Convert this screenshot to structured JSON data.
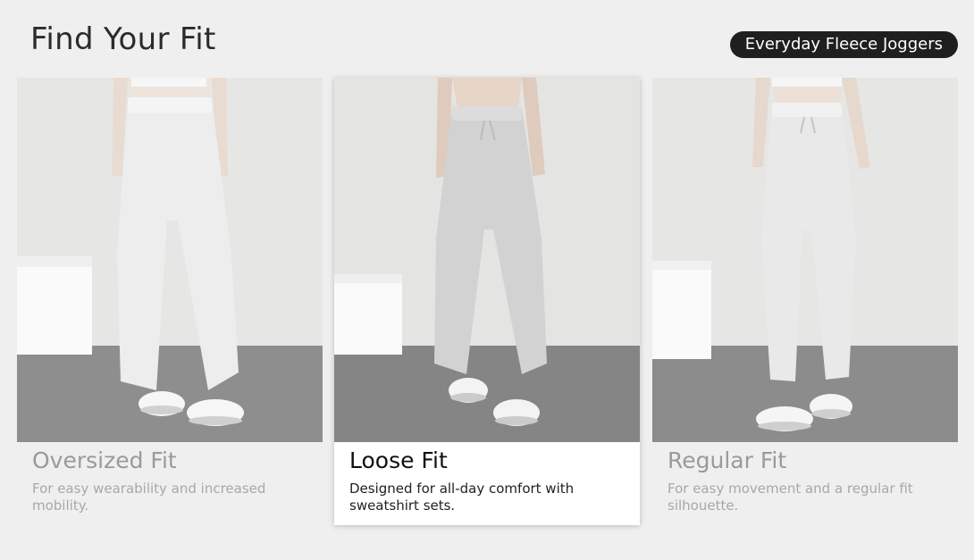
{
  "page": {
    "title": "Find Your Fit",
    "product": "Everyday Fleece Joggers"
  },
  "fits": [
    {
      "title": "Oversized Fit",
      "desc": "For easy wearability and increased mobility.",
      "selected": false
    },
    {
      "title": "Loose Fit",
      "desc": "Designed for all-day comfort with sweatshirt sets.",
      "selected": true
    },
    {
      "title": "Regular Fit",
      "desc": "For easy movement and a regular fit silhouette.",
      "selected": false
    }
  ]
}
